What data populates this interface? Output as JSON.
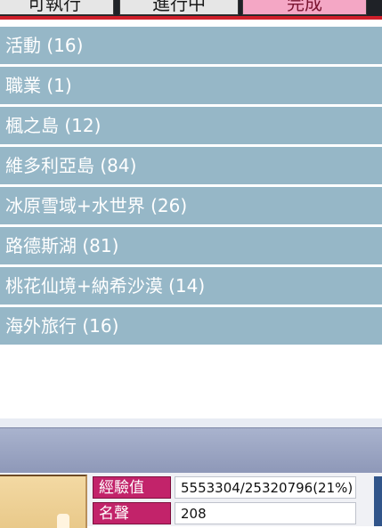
{
  "tabs": [
    {
      "label": "可執行",
      "active": false
    },
    {
      "label": "進行中",
      "active": false
    },
    {
      "label": "完成",
      "active": true
    }
  ],
  "categories": [
    {
      "label": "活動 (16)"
    },
    {
      "label": "職業 (1)"
    },
    {
      "label": "楓之島 (12)"
    },
    {
      "label": "維多利亞島 (84)"
    },
    {
      "label": "冰原雪域+水世界 (26)"
    },
    {
      "label": "路德斯湖 (81)"
    },
    {
      "label": "桃花仙境+納希沙漠 (14)"
    },
    {
      "label": "海外旅行 (16)"
    }
  ],
  "stats": {
    "exp_label": "經驗值",
    "exp_value": "5553304/25320796(21%)",
    "fame_label": "名聲",
    "fame_value": "208"
  },
  "colors": {
    "accent_red": "#cf1f2a",
    "row_blue": "#96b7c7",
    "active_tab": "#f4a7c5",
    "stat_label": "#c2236a"
  }
}
